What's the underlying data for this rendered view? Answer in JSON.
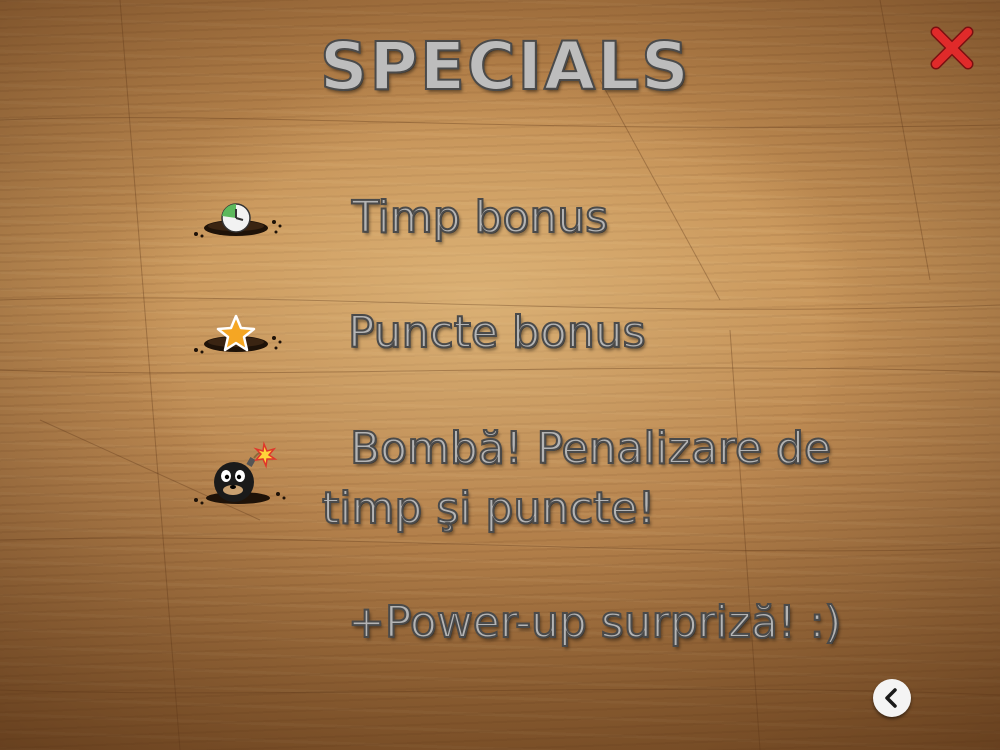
{
  "title": "SPECIALS",
  "items": [
    {
      "icon": "mole-clock-icon",
      "text": "Timp bonus"
    },
    {
      "icon": "mole-star-icon",
      "text": "Puncte bonus"
    },
    {
      "icon": "mole-bomb-icon",
      "text_line1": "Bombă! Penalizare de",
      "text_line2": "timp şi puncte!"
    },
    {
      "text": "+Power-up surpriză! :)"
    }
  ],
  "controls": {
    "close_icon": "close-icon",
    "back_icon": "back-arrow-icon"
  },
  "colors": {
    "text": "#b4b4b4",
    "outline": "#4a4a4a",
    "close": "#d32222",
    "wood": "#c9965a"
  }
}
